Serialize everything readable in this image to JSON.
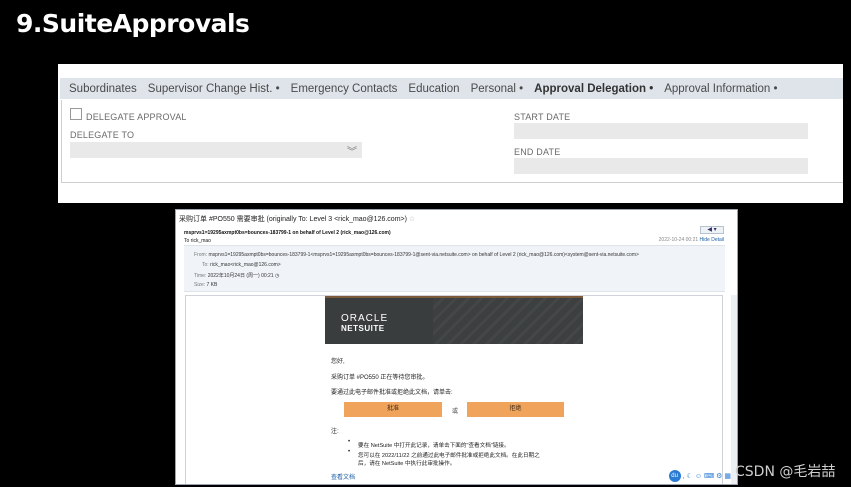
{
  "slide": {
    "title": "9.SuiteApprovals"
  },
  "tabs": [
    {
      "label": "Subordinates"
    },
    {
      "label": "Supervisor Change Hist. •"
    },
    {
      "label": "Emergency Contacts"
    },
    {
      "label": "Education"
    },
    {
      "label": "Personal •"
    },
    {
      "label": "Approval Delegation •",
      "active": true
    },
    {
      "label": "Approval Information •"
    }
  ],
  "form": {
    "delegate_approval_label": "DELEGATE APPROVAL",
    "delegate_approval_checked": false,
    "delegate_to_label": "DELEGATE TO",
    "delegate_to_value": "",
    "start_date_label": "START DATE",
    "start_date_value": "",
    "end_date_label": "END DATE",
    "end_date_value": ""
  },
  "email": {
    "subject": "采购订单 #PO550 需要审批 (originally To: Level 3 <rick_mao@126.com>)",
    "header_from": "msprvs1=19295axmpt0bs=bounces-183799-1 on behalf of Level 2 (rick_mao@126.com)",
    "header_to": "To rick_mao",
    "date": "2022-10-24 00:21",
    "hide_detail": "Hide Detail",
    "details_from_label": "From:",
    "details_from": "msprvs1=19295axmpt0bs=bounces-183799-1<msprvs1=19295axmpt0bs=bounces-183799-1@sent-via.netsuite.com> on behalf of Level 2 (rick_mao@126.com)<system@sent-via.netsuite.com>",
    "details_to_label": "To:",
    "details_to": "rick_mao<rick_mao@126.com>",
    "details_time_label": "Time:",
    "details_time": "2022年10月24日 (周一) 00:21",
    "details_size_label": "Size:",
    "details_size": "7 KB",
    "brand_line1": "ORACLE",
    "brand_line2": "NETSUITE",
    "greeting": "您好,",
    "line1": "采购订单 #PO550 正在等待您审批。",
    "line2": "要通过此电子邮件批准或拒绝此文档，请单击:",
    "approve_label": "批准",
    "or_label": "或",
    "reject_label": "拒绝",
    "note_label": "注:",
    "note1": "要在 NetSuite 中打开此记录，请单击下面的\"查看文档\"链接。",
    "note2a": "您可以在 2022/11/22 之前通过此电子邮件批准或拒绝此文档。在此日期之",
    "note2b": "后，请在 NetSuite 中执行此审批操作。",
    "view_doc": "查看文档",
    "tray_du": "du"
  },
  "watermark": "CSDN @毛岩喆"
}
